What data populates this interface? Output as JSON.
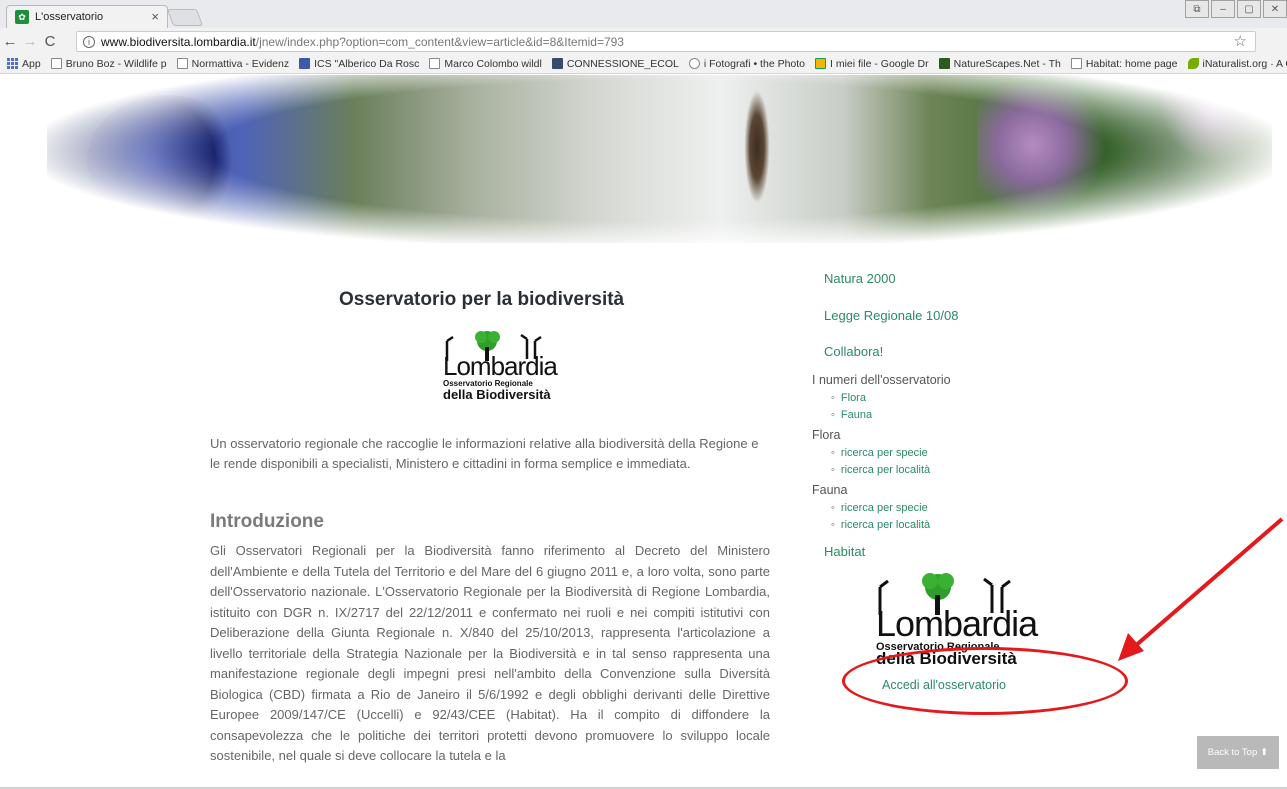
{
  "browser": {
    "tab_title": "L'osservatorio",
    "tab_close": "×",
    "url_host": "www.biodiversita.lombardia.it",
    "url_path": "/jnew/index.php?option=com_content&view=article&id=8&Itemid=793",
    "window_controls": [
      "⧉",
      "–",
      "▢",
      "✕"
    ]
  },
  "bookmarks": [
    "App",
    "Bruno Boz - Wildlife p",
    "Normattiva - Evidenz",
    "ICS \"Alberico Da Rosc",
    "Marco Colombo wildl",
    "CONNESSIONE_ECOL",
    "i Fotografi • the Photo",
    "I miei file - Google Dr",
    "NatureScapes.Net - Th",
    "Habitat: home page",
    "iNaturalist.org · A Cor",
    "»"
  ],
  "main": {
    "title": "Osservatorio per la biodiversità",
    "logo": {
      "word": "Lombardia",
      "line1": "Osservatorio Regionale",
      "line2": "della Biodiversità"
    },
    "intro": "Un osservatorio regionale che raccoglie le informazioni relative alla biodiversità della Regione e le rende disponibili a specialisti, Ministero e cittadini in forma semplice e immediata.",
    "section_heading": "Introduzione",
    "body": "Gli Osservatori Regionali per la Biodiversità fanno riferimento al Decreto del Ministero dell'Ambiente e della Tutela del Territorio e del Mare del 6 giugno 2011 e, a loro volta, sono parte dell'Osservatorio nazionale. L'Osservatorio Regionale per la Biodiversità di Regione Lombardia, istituito con DGR n. IX/2717 del 22/12/2011 e confermato nei ruoli e nei compiti istitutivi con Deliberazione della Giunta Regionale n. X/840 del 25/10/2013, rappresenta l'articolazione a livello territoriale della Strategia Nazionale per la Biodiversità e in tal senso rappresenta una manifestazione regionale degli impegni presi nell'ambito della Convenzione sulla Diversità Biologica (CBD) firmata a Rio de Janeiro il 5/6/1992 e degli obblighi derivanti delle Direttive Europee 2009/147/CE (Uccelli) e 92/43/CEE (Habitat). Ha il compito di diffondere la consapevolezza che le politiche dei territori protetti devono promuovere lo sviluppo locale sostenibile, nel quale si deve collocare la tutela e la"
  },
  "sidebar": {
    "natura2000": "Natura 2000",
    "legge": "Legge Regionale 10/08",
    "collabora": "Collabora!",
    "numeri_head": "I numeri dell'osservatorio",
    "numeri_items": [
      "Flora",
      "Fauna"
    ],
    "flora_head": "Flora",
    "flora_items": [
      "ricerca per specie",
      "ricerca per località"
    ],
    "fauna_head": "Fauna",
    "fauna_items": [
      "ricerca per specie",
      "ricerca per località"
    ],
    "habitat": "Habitat",
    "logo": {
      "word": "Lombardia",
      "line1": "Osservatorio Regionale",
      "line2": "della Biodiversità"
    },
    "accedi": "Accedi all'osservatorio"
  },
  "back_to_top": "Back to Top",
  "colors": {
    "link": "#2a8a63",
    "annotation": "#e3191c"
  }
}
